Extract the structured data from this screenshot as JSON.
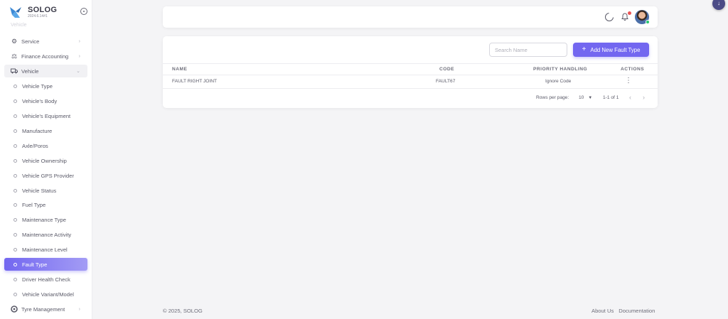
{
  "brand": {
    "name": "SOLOG",
    "version": "2024.6.14#1",
    "faded_item": "Vehicle"
  },
  "sidebar": {
    "items": [
      {
        "label": "Service",
        "icon": "service-icon"
      },
      {
        "label": "Finance Accounting",
        "icon": "finance-icon"
      },
      {
        "label": "Vehicle",
        "icon": "truck-icon"
      }
    ],
    "vehicle_sub": [
      "Vehicle Type",
      "Vehicle's Body",
      "Vehicle's Equipment",
      "Manufacture",
      "Axle/Poros",
      "Vehicle Ownership",
      "Vehicle GPS Provider",
      "Vehicle Status",
      "Fuel Type",
      "Maintenance Type",
      "Maintenance Activity",
      "Maintenance Level",
      "Fault Type",
      "Driver Health Check",
      "Vehicle Variant/Model"
    ],
    "active": "Fault Type",
    "last_item": {
      "label": "Tyre Management",
      "icon": "tyre-icon"
    }
  },
  "toolbar": {
    "search_placeholder": "Search Name",
    "add_button": "Add New Fault Type"
  },
  "table": {
    "headers": [
      "NAME",
      "CODE",
      "PRIORITY HANDLING",
      "ACTIONS"
    ],
    "rows": [
      {
        "name": "FAULT RIGHT JOINT",
        "code": "FAULT67",
        "priority": "Ignore Code"
      }
    ]
  },
  "pagination": {
    "rows_label": "Rows per page:",
    "rows_value": "10",
    "range": "1-1 of 1"
  },
  "footer": {
    "copyright": "© 2025, SOLOG",
    "about": "About Us",
    "docs": "Documentation"
  },
  "colors": {
    "accent": "#7367f0",
    "notification": "#ea5455",
    "online": "#28c76f"
  }
}
